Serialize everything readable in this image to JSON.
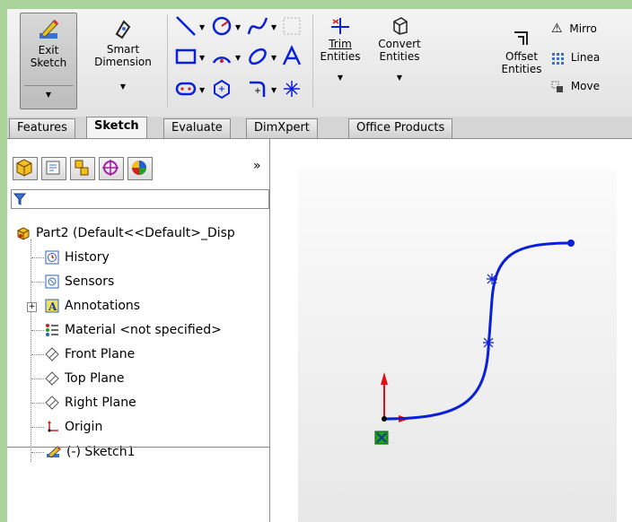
{
  "ribbon": {
    "exit_sketch": "Exit\nSketch",
    "exit_line1": "Exit",
    "exit_line2": "Sketch",
    "smart_line1": "Smart",
    "smart_line2": "Dimension",
    "trim_line1": "Trim",
    "trim_line2": "Entities",
    "convert_line1": "Convert",
    "convert_line2": "Entities",
    "offset_line1": "Offset",
    "offset_line2": "Entities",
    "mirror_label": "Mirro",
    "linear_label": "Linea",
    "move_label": "Move"
  },
  "tabs": [
    "Features",
    "Sketch",
    "Evaluate",
    "DimXpert",
    "Office Products"
  ],
  "active_tab": "Sketch",
  "panel": {
    "expand_glyph": "»"
  },
  "tree": [
    {
      "label": "Part2  (Default<<Default>_Disp",
      "icon": "part-icon"
    },
    {
      "label": "History",
      "icon": "history-icon"
    },
    {
      "label": "Sensors",
      "icon": "sensors-icon"
    },
    {
      "label": "Annotations",
      "icon": "annotations-icon"
    },
    {
      "label": "Material <not specified>",
      "icon": "material-icon"
    },
    {
      "label": "Front Plane",
      "icon": "plane-icon"
    },
    {
      "label": "Top Plane",
      "icon": "plane-icon"
    },
    {
      "label": "Right Plane",
      "icon": "plane-icon"
    },
    {
      "label": "Origin",
      "icon": "origin-icon"
    },
    {
      "label": "(-) Sketch1",
      "icon": "sketch-icon"
    }
  ],
  "colors": {
    "curve": "#0a1fd8",
    "axis_y": "#e01010",
    "frame_bg": "#a9d39a"
  }
}
